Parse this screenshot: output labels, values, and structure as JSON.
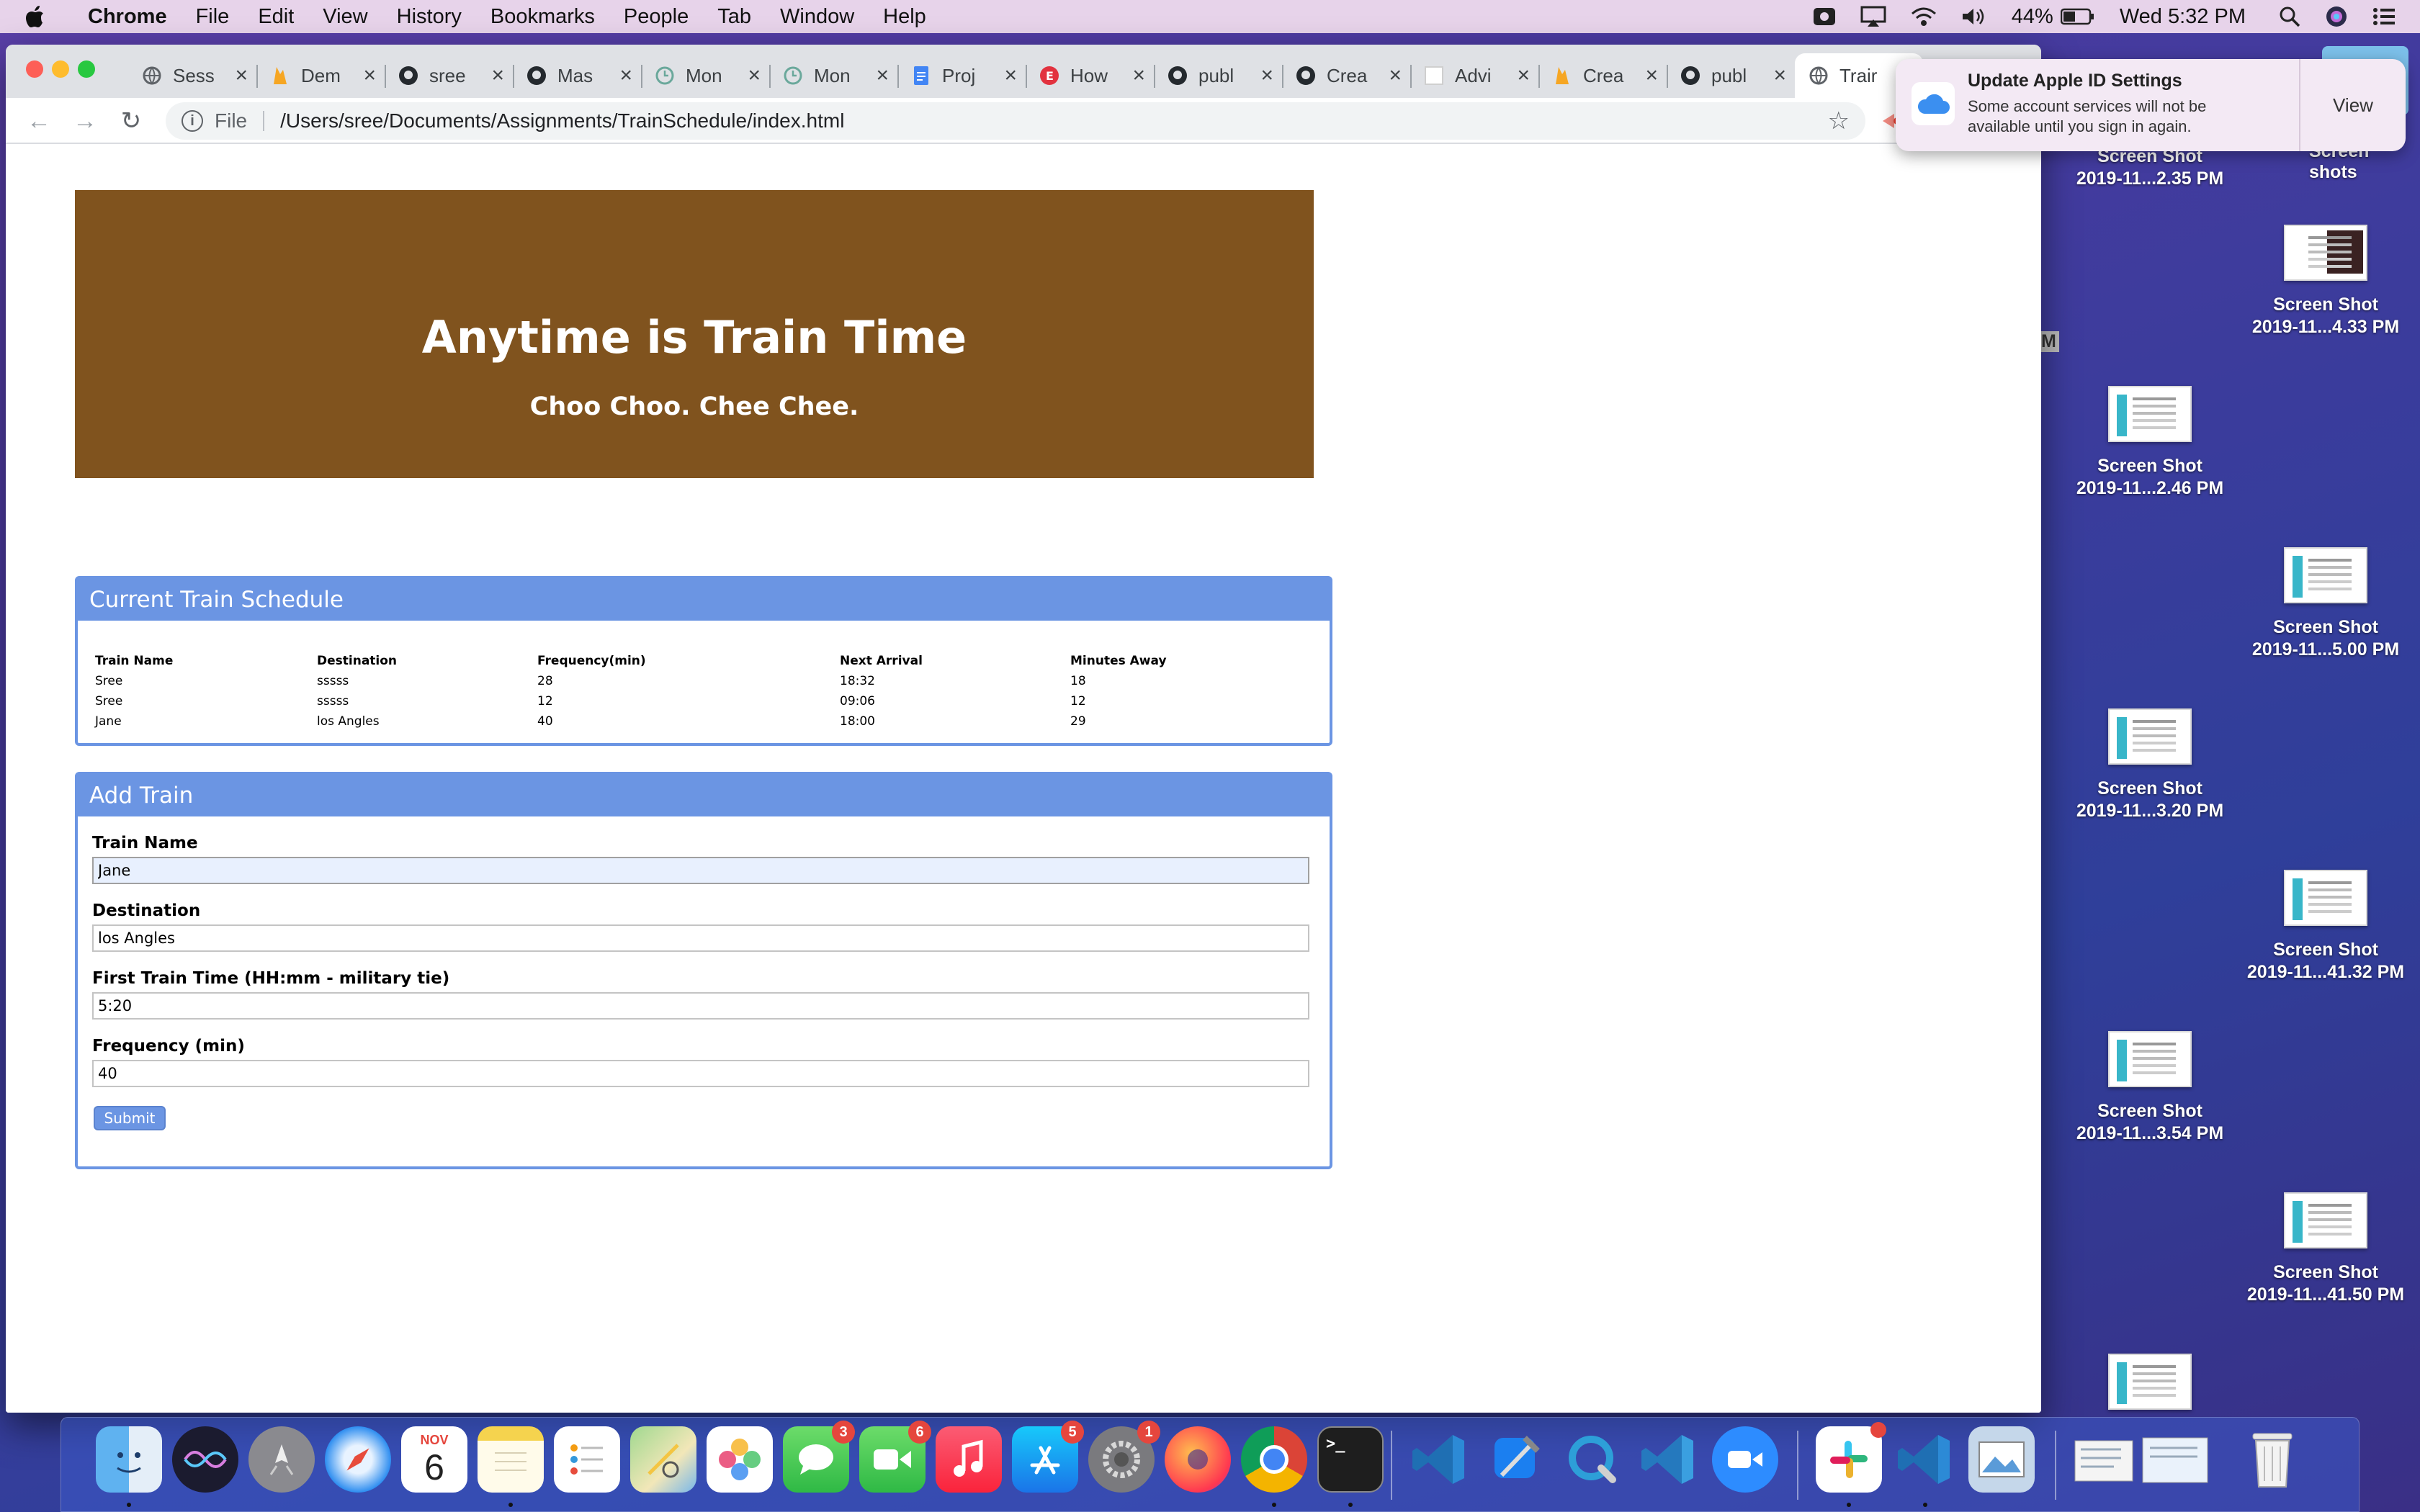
{
  "menubar": {
    "app_name": "Chrome",
    "items": [
      "File",
      "Edit",
      "View",
      "History",
      "Bookmarks",
      "People",
      "Tab",
      "Window",
      "Help"
    ],
    "battery": "44%",
    "clock": "Wed 5:32 PM"
  },
  "browser": {
    "tabs": [
      {
        "title": "Sess",
        "icon": "globe-icon"
      },
      {
        "title": "Dem",
        "icon": "firebase-icon"
      },
      {
        "title": "sree",
        "icon": "github-icon"
      },
      {
        "title": "Mas",
        "icon": "github-icon"
      },
      {
        "title": "Mon",
        "icon": "clock-icon"
      },
      {
        "title": "Mon",
        "icon": "clock-icon"
      },
      {
        "title": "Proj",
        "icon": "docs-icon"
      },
      {
        "title": "How",
        "icon": "e-icon"
      },
      {
        "title": "publ",
        "icon": "github-icon"
      },
      {
        "title": "Crea",
        "icon": "github-icon"
      },
      {
        "title": "Advi",
        "icon": "blank-page-icon"
      },
      {
        "title": "Crea",
        "icon": "firebase-icon"
      },
      {
        "title": "publ",
        "icon": "github-icon"
      },
      {
        "title": "Trair",
        "icon": "globe-icon",
        "active": true
      }
    ],
    "omnibox": {
      "scheme": "File",
      "url": "/Users/sree/Documents/Assignments/TrainSchedule/index.html"
    }
  },
  "page": {
    "jumbotron": {
      "title": "Anytime is Train Time",
      "subtitle": "Choo Choo. Chee Chee."
    },
    "schedule": {
      "heading": "Current Train Schedule",
      "columns": [
        "Train Name",
        "Destination",
        "Frequency(min)",
        "Next Arrival",
        "Minutes Away"
      ],
      "rows": [
        [
          "Sree",
          "sssss",
          "28",
          "18:32",
          "18"
        ],
        [
          "Sree",
          "sssss",
          "12",
          "09:06",
          "12"
        ],
        [
          "Jane",
          "los Angles",
          "40",
          "18:00",
          "29"
        ]
      ]
    },
    "add_train": {
      "heading": "Add Train",
      "fields": [
        {
          "label": "Train Name",
          "value": "Jane"
        },
        {
          "label": "Destination",
          "value": "los Angles"
        },
        {
          "label": "First Train Time (HH:mm - military tie)",
          "value": "5:20"
        },
        {
          "label": "Frequency (min)",
          "value": "40"
        }
      ],
      "submit_label": "Submit"
    }
  },
  "notification": {
    "title": "Update Apple ID Settings",
    "body": "Some account services will not be available until you sign in again.",
    "action": "View"
  },
  "desktop": {
    "icons": [
      {
        "line1": "Screen Shot",
        "line2": "2019-11...2.35 PM"
      },
      {
        "line1": "Screen Shot",
        "line2": "2019-11...4.33 PM"
      },
      {
        "line1": "Screen Shot",
        "line2": "2019-11...2.46 PM"
      },
      {
        "line1": "Screen Shot",
        "line2": "2019-11...5.00 PM"
      },
      {
        "line1": "Screen Shot",
        "line2": "2019-11...3.20 PM"
      },
      {
        "line1": "Screen Shot",
        "line2": "2019-11...41.32 PM"
      },
      {
        "line1": "Screen Shot",
        "line2": "2019-11...3.54 PM"
      },
      {
        "line1": "Screen Shot",
        "line2": "2019-11...41.50 PM"
      }
    ],
    "folder_label": "Screen shots",
    "edge_m": "M"
  },
  "dock": {
    "calendar_month": "NOV",
    "calendar_day": "6",
    "badges": {
      "messages": "3",
      "facetime": "6",
      "appstore": "5",
      "sysprefs": "1"
    },
    "apps": [
      "finder-icon",
      "siri-icon",
      "launchpad-icon",
      "safari-icon",
      "calendar-icon",
      "notes-icon",
      "reminders-icon",
      "maps-icon",
      "photos-icon",
      "messages-icon",
      "facetime-icon",
      "music-icon",
      "appstore-icon",
      "sysprefs-icon",
      "firefox-icon",
      "chrome-icon",
      "terminal-icon",
      "vscode-icon",
      "xcode-icon",
      "quicktime-icon",
      "vscode-insiders-icon",
      "zoom-icon",
      "slack-icon",
      "vscode-icon",
      "preview-icon",
      "documents-icon",
      "trash-icon"
    ]
  }
}
